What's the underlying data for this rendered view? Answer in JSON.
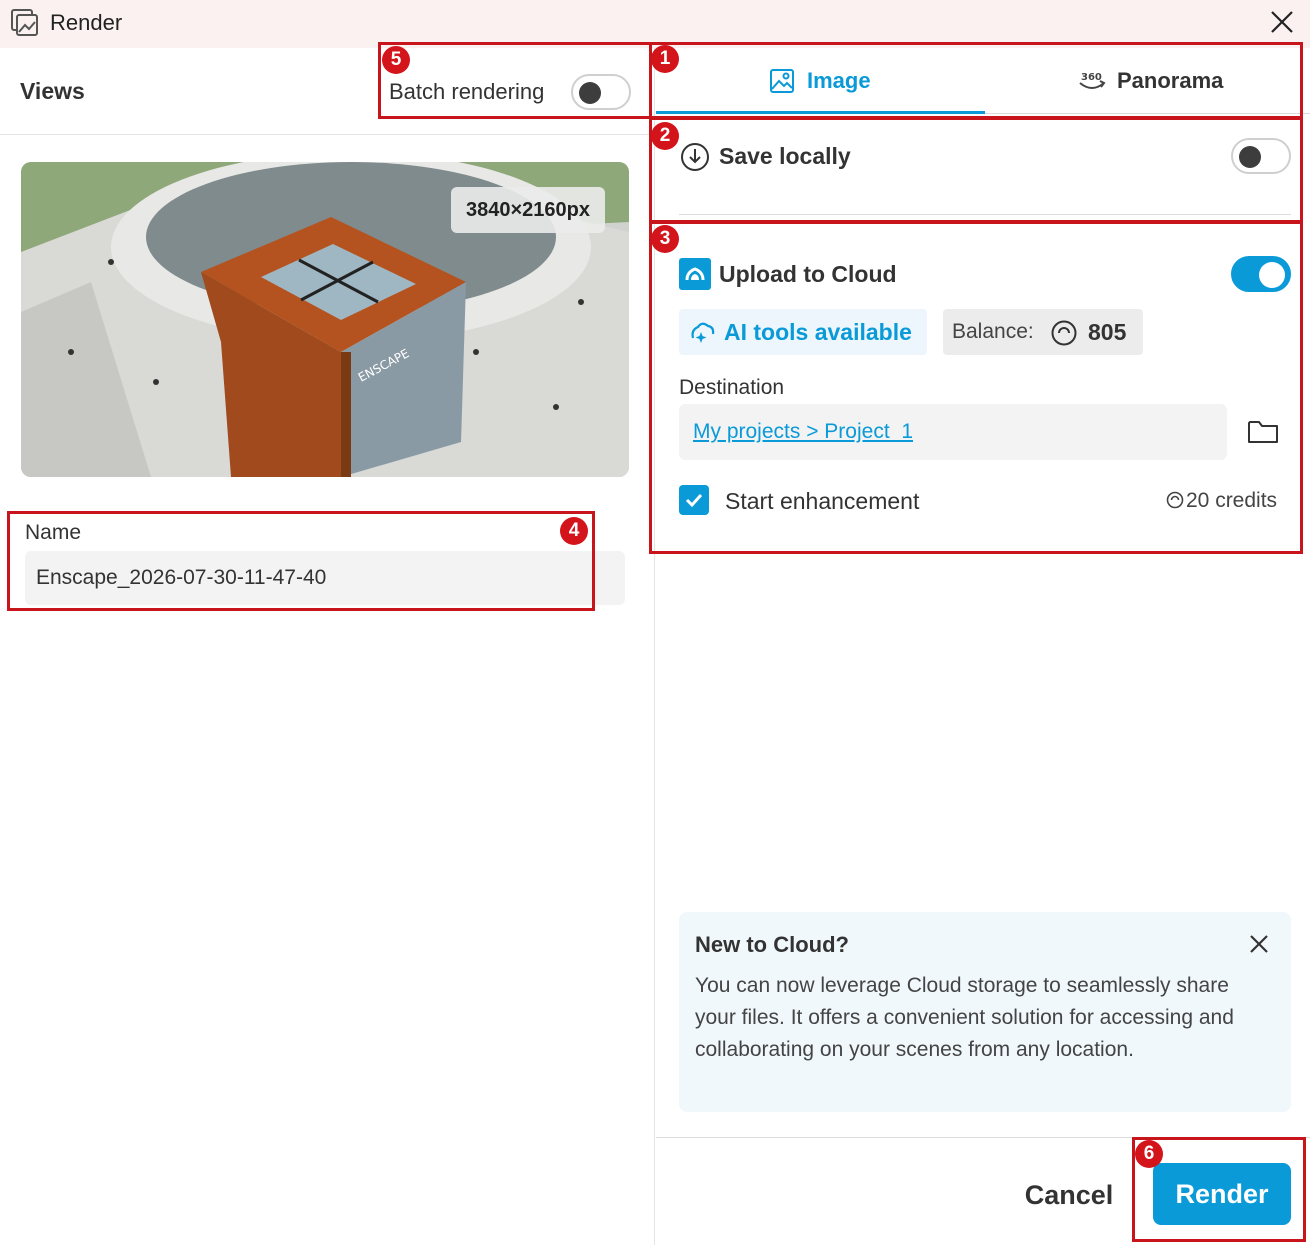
{
  "window": {
    "title": "Render",
    "close_icon": "close-icon",
    "app_icon": "render-images-icon"
  },
  "left": {
    "views_label": "Views",
    "batch_label": "Batch rendering",
    "batch_on": false,
    "preview_resolution": "3840×2160px",
    "name_label": "Name",
    "name_value": "Enscape_2026-07-30-11-47-40",
    "preview_sign_text": "ENSCAPE"
  },
  "tabs": [
    {
      "label": "Image",
      "icon": "image-icon",
      "active": true
    },
    {
      "label": "Panorama",
      "icon": "panorama-360-icon",
      "badge": "360",
      "active": false
    }
  ],
  "save_locally": {
    "label": "Save locally",
    "icon": "download-circle-icon",
    "on": false
  },
  "cloud": {
    "label": "Upload to Cloud",
    "icon": "cloud-icon",
    "on": true,
    "ai_label": "AI tools available",
    "balance_label": "Balance:",
    "balance_value": "805",
    "destination_label": "Destination",
    "destination_value": "My projects > Project_1",
    "folder_icon": "folder-icon",
    "enhance_label": "Start enhancement",
    "enhance_checked": true,
    "enhance_credits": "20 credits"
  },
  "info": {
    "title": "New to Cloud?",
    "body": "You can now leverage Cloud storage to seamlessly share your files. It offers a convenient solution for accessing and collaborating on your scenes from any location."
  },
  "footer": {
    "cancel_label": "Cancel",
    "render_label": "Render"
  },
  "colors": {
    "accent": "#0b9ad8",
    "annotation": "#c8151b",
    "titlebar": "#fbf1f1"
  },
  "annotations": [
    "1",
    "2",
    "3",
    "4",
    "5",
    "6"
  ]
}
